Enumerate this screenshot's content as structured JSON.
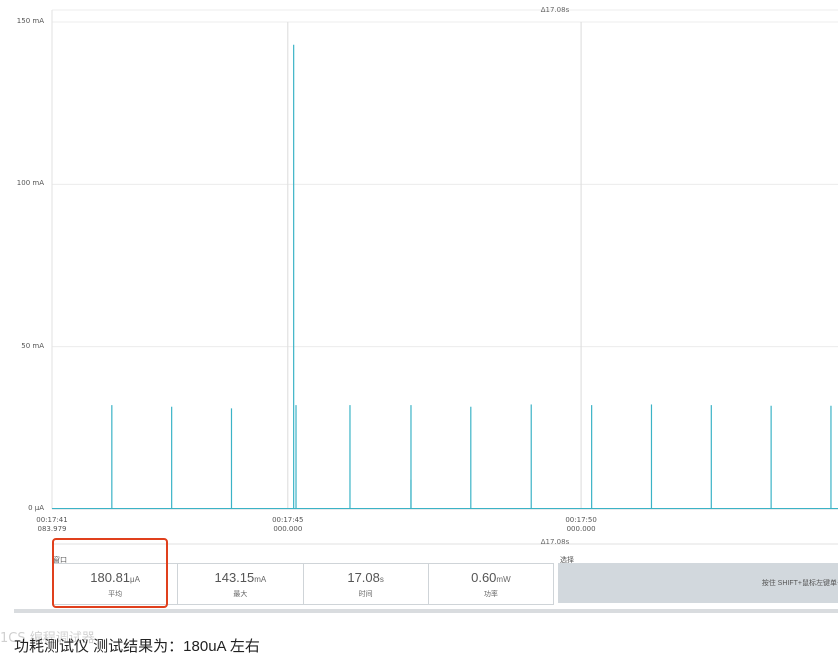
{
  "chart_data": {
    "type": "line",
    "title": "",
    "delta_label": "Δ17.08s",
    "yticks": [
      {
        "value": 150,
        "label": "150 mA"
      },
      {
        "value": 100,
        "label": "100 mA"
      },
      {
        "value": 50,
        "label": "50 mA"
      },
      {
        "value": 0,
        "label": "0 μA"
      }
    ],
    "ylim": [
      0,
      150
    ],
    "xticks": [
      {
        "time": 0,
        "line1": "00:17:41",
        "line2": "083.979"
      },
      {
        "time": 4.02,
        "line1": "00:17:45",
        "line2": "000.000"
      },
      {
        "time": 9.02,
        "line1": "00:17:50",
        "line2": "000.000"
      }
    ],
    "xlim": [
      0,
      13.4
    ],
    "grid": true,
    "series_color": "#3bb3c6",
    "spikes": [
      {
        "t": 1.02,
        "mA": 32
      },
      {
        "t": 2.04,
        "mA": 31.5
      },
      {
        "t": 3.06,
        "mA": 31
      },
      {
        "t": 4.12,
        "mA": 143
      },
      {
        "t": 4.16,
        "mA": 32
      },
      {
        "t": 5.08,
        "mA": 32
      },
      {
        "t": 6.12,
        "mA": 32
      },
      {
        "t": 6.12,
        "mA": 9
      },
      {
        "t": 7.14,
        "mA": 31.5
      },
      {
        "t": 8.17,
        "mA": 32.2
      },
      {
        "t": 9.2,
        "mA": 32
      },
      {
        "t": 10.22,
        "mA": 32.2
      },
      {
        "t": 11.24,
        "mA": 32
      },
      {
        "t": 12.26,
        "mA": 31.8
      },
      {
        "t": 13.28,
        "mA": 31.8
      }
    ]
  },
  "bottom": {
    "delta_label": "Δ17.08s",
    "window_label": "窗口",
    "selection_label": "选择",
    "stats": [
      {
        "value": "180.81",
        "unit": "μA",
        "caption": "平均"
      },
      {
        "value": "143.15",
        "unit": "mA",
        "caption": "最大"
      },
      {
        "value": "17.08",
        "unit": "s",
        "caption": "时间"
      },
      {
        "value": "0.60",
        "unit": "mW",
        "caption": "功率"
      }
    ],
    "selection_hint": "按住 SHIFT+鼠标左键单击并拖"
  },
  "caption": "功耗测试仪 测试结果为：180uA 左右",
  "watermark": "1CS 编程调试器",
  "colors": {
    "highlight": "#e0401d",
    "series": "#3bb3c6",
    "panel": "#d2d8dd"
  }
}
